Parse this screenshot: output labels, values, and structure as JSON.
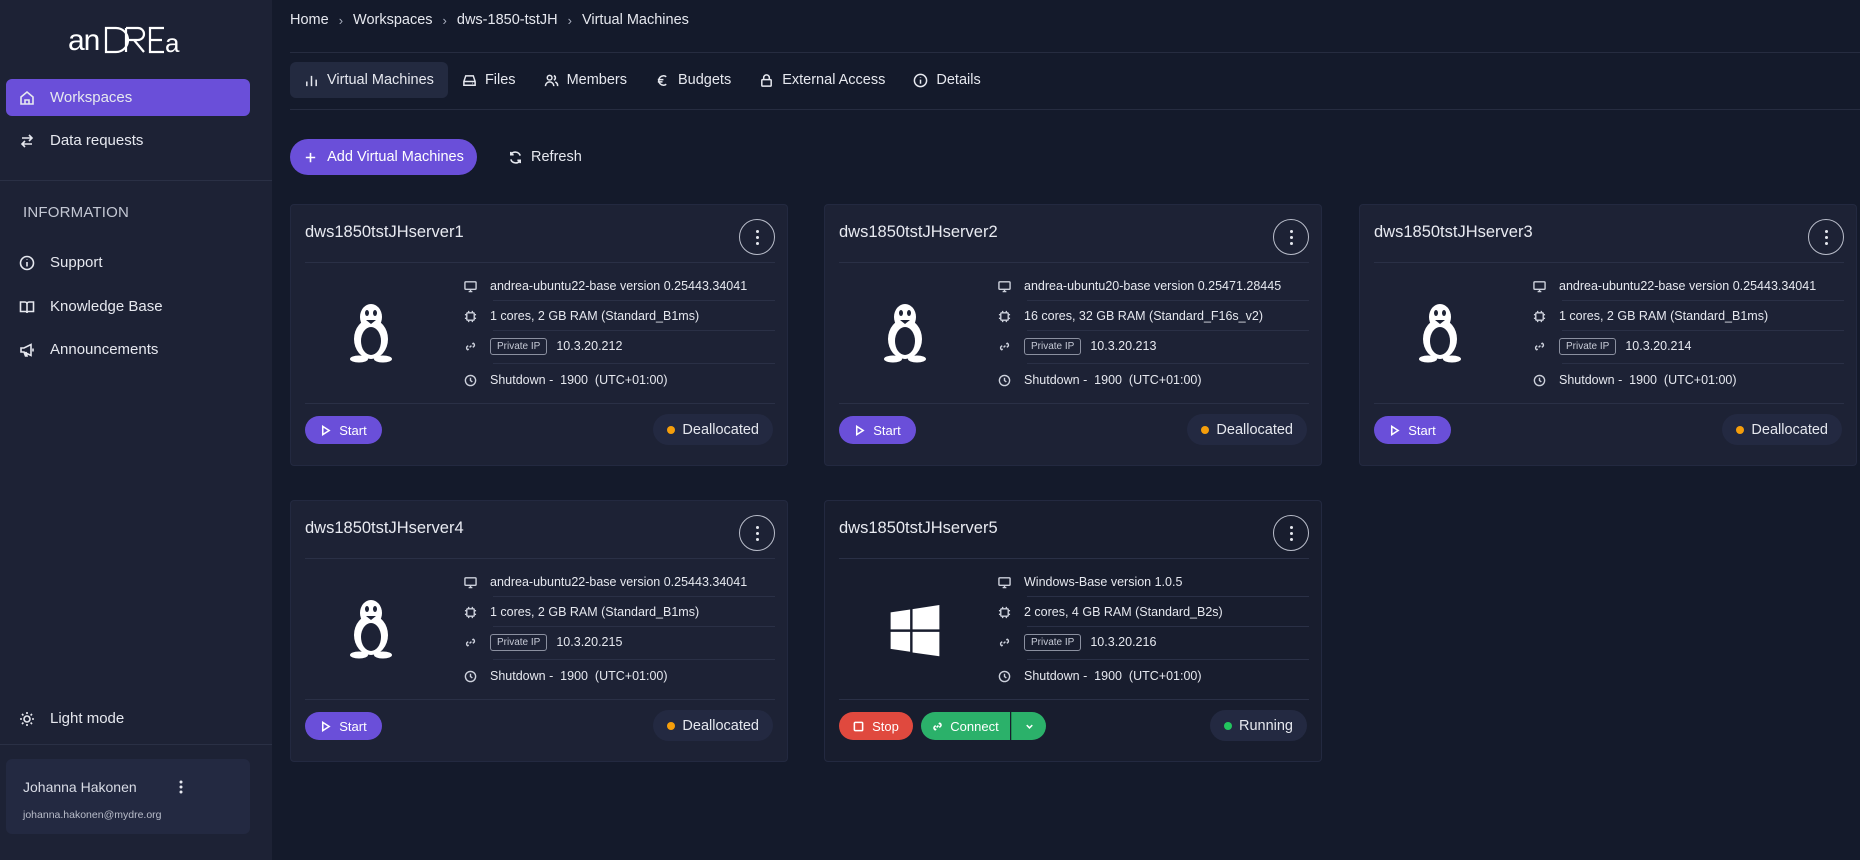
{
  "sidebar": {
    "logo_text": "anDREa",
    "nav": [
      {
        "label": "Workspaces",
        "icon": "home-icon",
        "active": true
      },
      {
        "label": "Data requests",
        "icon": "swap-arrows-icon"
      }
    ],
    "info_title": "INFORMATION",
    "info_items": [
      {
        "label": "Support",
        "icon": "info-circle-icon"
      },
      {
        "label": "Knowledge Base",
        "icon": "book-icon"
      },
      {
        "label": "Announcements",
        "icon": "megaphone-icon"
      }
    ],
    "theme_toggle": {
      "label": "Light mode",
      "icon": "sun-icon"
    },
    "user": {
      "name": "Johanna Hakonen",
      "email": "johanna.hakonen@mydre.org"
    }
  },
  "breadcrumb": [
    "Home",
    "Workspaces",
    "dws-1850-tstJH",
    "Virtual Machines"
  ],
  "tabs": [
    {
      "label": "Virtual Machines",
      "icon": "bar-chart-icon",
      "active": true
    },
    {
      "label": "Files",
      "icon": "drive-icon"
    },
    {
      "label": "Members",
      "icon": "users-icon"
    },
    {
      "label": "Budgets",
      "icon": "euro-icon"
    },
    {
      "label": "External Access",
      "icon": "lock-icon"
    },
    {
      "label": "Details",
      "icon": "info-icon"
    }
  ],
  "actions": {
    "add_label": "Add Virtual Machines",
    "refresh_label": "Refresh"
  },
  "vms": [
    {
      "name": "dws1850tstJHserver1",
      "os": "linux",
      "image": "andrea-ubuntu22-base version 0.25443.34041",
      "size": "1 cores, 2 GB RAM (Standard_B1ms)",
      "ip_badge": "Private IP",
      "ip": "10.3.20.212",
      "shutdown": "Shutdown -  1900  (UTC+01:00)",
      "status": "Deallocated",
      "status_color": "#f59e0b",
      "start_label": "Start"
    },
    {
      "name": "dws1850tstJHserver2",
      "os": "linux",
      "image": "andrea-ubuntu20-base version 0.25471.28445",
      "size": "16 cores, 32 GB RAM (Standard_F16s_v2)",
      "ip_badge": "Private IP",
      "ip": "10.3.20.213",
      "shutdown": "Shutdown -  1900  (UTC+01:00)",
      "status": "Deallocated",
      "status_color": "#f59e0b",
      "start_label": "Start"
    },
    {
      "name": "dws1850tstJHserver3",
      "os": "linux",
      "image": "andrea-ubuntu22-base version 0.25443.34041",
      "size": "1 cores, 2 GB RAM (Standard_B1ms)",
      "ip_badge": "Private IP",
      "ip": "10.3.20.214",
      "shutdown": "Shutdown -  1900  (UTC+01:00)",
      "status": "Deallocated",
      "status_color": "#f59e0b",
      "start_label": "Start"
    },
    {
      "name": "dws1850tstJHserver4",
      "os": "linux",
      "image": "andrea-ubuntu22-base version 0.25443.34041",
      "size": "1 cores, 2 GB RAM (Standard_B1ms)",
      "ip_badge": "Private IP",
      "ip": "10.3.20.215",
      "shutdown": "Shutdown -  1900  (UTC+01:00)",
      "status": "Deallocated",
      "status_color": "#f59e0b",
      "start_label": "Start"
    },
    {
      "name": "dws1850tstJHserver5",
      "os": "windows",
      "image": "Windows-Base version 1.0.5",
      "size": "2 cores, 4 GB RAM (Standard_B2s)",
      "ip_badge": "Private IP",
      "ip": "10.3.20.216",
      "shutdown": "Shutdown -  1900  (UTC+01:00)",
      "status": "Running",
      "status_color": "#22c55e",
      "stop_label": "Stop",
      "connect_label": "Connect"
    }
  ],
  "colors": {
    "accent": "#6a4fd9",
    "stop": "#e0493e",
    "connect": "#2bb16a",
    "background": "#141a2b",
    "sidebar": "#1d2235"
  }
}
